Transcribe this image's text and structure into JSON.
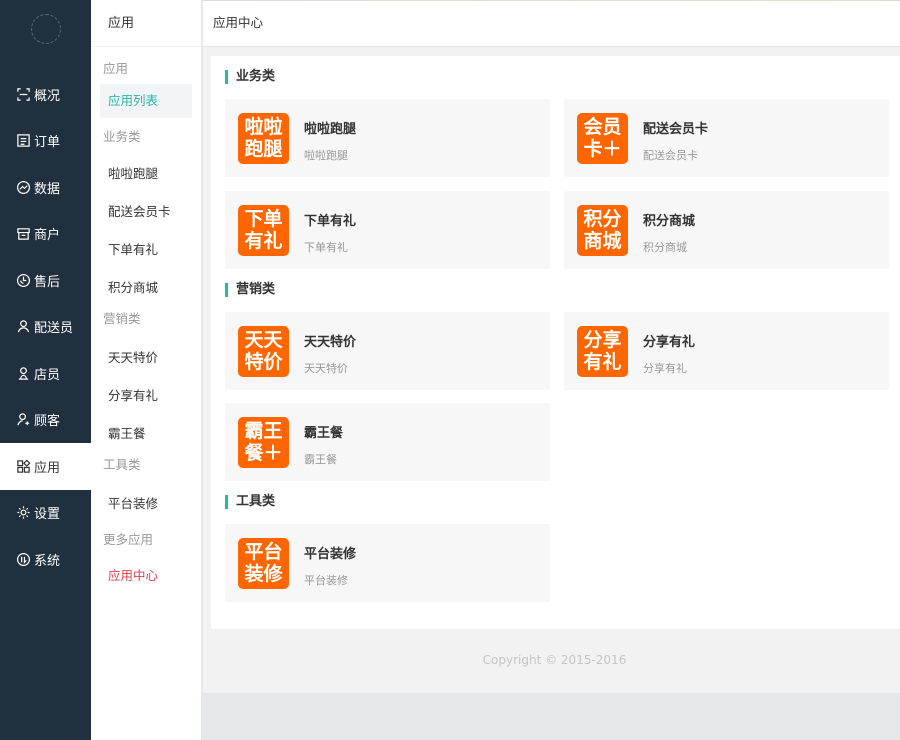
{
  "sidebar": {
    "items": [
      {
        "label": "概况",
        "icon": "overview-icon"
      },
      {
        "label": "订单",
        "icon": "order-icon"
      },
      {
        "label": "数据",
        "icon": "chart-icon"
      },
      {
        "label": "商户",
        "icon": "store-icon"
      },
      {
        "label": "售后",
        "icon": "after-sales-icon"
      },
      {
        "label": "配送员",
        "icon": "courier-icon"
      },
      {
        "label": "店员",
        "icon": "staff-icon"
      },
      {
        "label": "顾客",
        "icon": "customer-icon"
      },
      {
        "label": "应用",
        "icon": "apps-icon"
      },
      {
        "label": "设置",
        "icon": "gear-icon"
      },
      {
        "label": "系统",
        "icon": "system-icon"
      }
    ],
    "active_index": 8
  },
  "subnav": {
    "title": "应用",
    "group_app": "应用",
    "item_app_list": "应用列表",
    "group_business": "业务类",
    "item_lala": "啦啦跑腿",
    "item_member": "配送会员卡",
    "item_order_gift": "下单有礼",
    "item_points": "积分商城",
    "group_marketing": "营销类",
    "item_daily": "天天特价",
    "item_share": "分享有礼",
    "item_combo": "霸王餐",
    "group_tools": "工具类",
    "item_decor": "平台装修",
    "group_more": "更多应用",
    "item_center": "应用中心"
  },
  "header": {
    "title": "应用中心"
  },
  "sections": {
    "business": "业务类",
    "marketing": "营销类",
    "tools": "工具类"
  },
  "cards": [
    {
      "icon_l1": "啦啦",
      "icon_l2": "跑腿",
      "name": "啦啦跑腿",
      "desc": "啦啦跑腿"
    },
    {
      "icon_l1": "会员",
      "icon_l2": "卡＋",
      "name": "配送会员卡",
      "desc": "配送会员卡"
    },
    {
      "icon_l1": "下单",
      "icon_l2": "有礼",
      "name": "下单有礼",
      "desc": "下单有礼"
    },
    {
      "icon_l1": "积分",
      "icon_l2": "商城",
      "name": "积分商城",
      "desc": "积分商城"
    },
    {
      "icon_l1": "天天",
      "icon_l2": "特价",
      "name": "天天特价",
      "desc": "天天特价"
    },
    {
      "icon_l1": "分享",
      "icon_l2": "有礼",
      "name": "分享有礼",
      "desc": "分享有礼"
    },
    {
      "icon_l1": "霸王",
      "icon_l2": "餐＋",
      "name": "霸王餐",
      "desc": "霸王餐"
    },
    {
      "icon_l1": "平台",
      "icon_l2": "装修",
      "name": "平台装修",
      "desc": "平台装修"
    }
  ],
  "footer": {
    "copyright": "Copyright © 2015-2016"
  },
  "colors": {
    "sidebar_bg": "#21303f",
    "accent": "#29b6ac",
    "icon_orange": "#ff6600",
    "more_red": "#e33f4b"
  }
}
